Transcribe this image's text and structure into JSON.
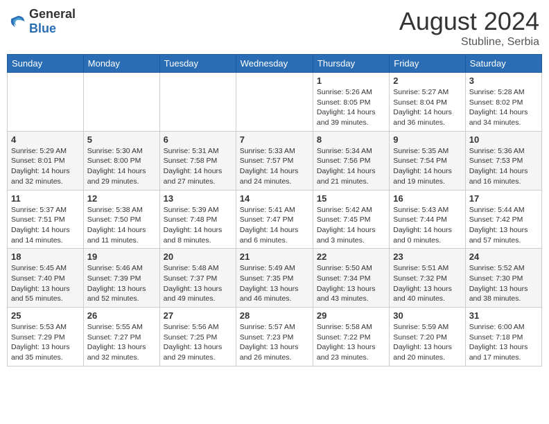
{
  "header": {
    "logo_general": "General",
    "logo_blue": "Blue",
    "title": "August 2024",
    "subtitle": "Stubline, Serbia"
  },
  "weekdays": [
    "Sunday",
    "Monday",
    "Tuesday",
    "Wednesday",
    "Thursday",
    "Friday",
    "Saturday"
  ],
  "weeks": [
    [
      {
        "day": "",
        "detail": ""
      },
      {
        "day": "",
        "detail": ""
      },
      {
        "day": "",
        "detail": ""
      },
      {
        "day": "",
        "detail": ""
      },
      {
        "day": "1",
        "detail": "Sunrise: 5:26 AM\nSunset: 8:05 PM\nDaylight: 14 hours\nand 39 minutes."
      },
      {
        "day": "2",
        "detail": "Sunrise: 5:27 AM\nSunset: 8:04 PM\nDaylight: 14 hours\nand 36 minutes."
      },
      {
        "day": "3",
        "detail": "Sunrise: 5:28 AM\nSunset: 8:02 PM\nDaylight: 14 hours\nand 34 minutes."
      }
    ],
    [
      {
        "day": "4",
        "detail": "Sunrise: 5:29 AM\nSunset: 8:01 PM\nDaylight: 14 hours\nand 32 minutes."
      },
      {
        "day": "5",
        "detail": "Sunrise: 5:30 AM\nSunset: 8:00 PM\nDaylight: 14 hours\nand 29 minutes."
      },
      {
        "day": "6",
        "detail": "Sunrise: 5:31 AM\nSunset: 7:58 PM\nDaylight: 14 hours\nand 27 minutes."
      },
      {
        "day": "7",
        "detail": "Sunrise: 5:33 AM\nSunset: 7:57 PM\nDaylight: 14 hours\nand 24 minutes."
      },
      {
        "day": "8",
        "detail": "Sunrise: 5:34 AM\nSunset: 7:56 PM\nDaylight: 14 hours\nand 21 minutes."
      },
      {
        "day": "9",
        "detail": "Sunrise: 5:35 AM\nSunset: 7:54 PM\nDaylight: 14 hours\nand 19 minutes."
      },
      {
        "day": "10",
        "detail": "Sunrise: 5:36 AM\nSunset: 7:53 PM\nDaylight: 14 hours\nand 16 minutes."
      }
    ],
    [
      {
        "day": "11",
        "detail": "Sunrise: 5:37 AM\nSunset: 7:51 PM\nDaylight: 14 hours\nand 14 minutes."
      },
      {
        "day": "12",
        "detail": "Sunrise: 5:38 AM\nSunset: 7:50 PM\nDaylight: 14 hours\nand 11 minutes."
      },
      {
        "day": "13",
        "detail": "Sunrise: 5:39 AM\nSunset: 7:48 PM\nDaylight: 14 hours\nand 8 minutes."
      },
      {
        "day": "14",
        "detail": "Sunrise: 5:41 AM\nSunset: 7:47 PM\nDaylight: 14 hours\nand 6 minutes."
      },
      {
        "day": "15",
        "detail": "Sunrise: 5:42 AM\nSunset: 7:45 PM\nDaylight: 14 hours\nand 3 minutes."
      },
      {
        "day": "16",
        "detail": "Sunrise: 5:43 AM\nSunset: 7:44 PM\nDaylight: 14 hours\nand 0 minutes."
      },
      {
        "day": "17",
        "detail": "Sunrise: 5:44 AM\nSunset: 7:42 PM\nDaylight: 13 hours\nand 57 minutes."
      }
    ],
    [
      {
        "day": "18",
        "detail": "Sunrise: 5:45 AM\nSunset: 7:40 PM\nDaylight: 13 hours\nand 55 minutes."
      },
      {
        "day": "19",
        "detail": "Sunrise: 5:46 AM\nSunset: 7:39 PM\nDaylight: 13 hours\nand 52 minutes."
      },
      {
        "day": "20",
        "detail": "Sunrise: 5:48 AM\nSunset: 7:37 PM\nDaylight: 13 hours\nand 49 minutes."
      },
      {
        "day": "21",
        "detail": "Sunrise: 5:49 AM\nSunset: 7:35 PM\nDaylight: 13 hours\nand 46 minutes."
      },
      {
        "day": "22",
        "detail": "Sunrise: 5:50 AM\nSunset: 7:34 PM\nDaylight: 13 hours\nand 43 minutes."
      },
      {
        "day": "23",
        "detail": "Sunrise: 5:51 AM\nSunset: 7:32 PM\nDaylight: 13 hours\nand 40 minutes."
      },
      {
        "day": "24",
        "detail": "Sunrise: 5:52 AM\nSunset: 7:30 PM\nDaylight: 13 hours\nand 38 minutes."
      }
    ],
    [
      {
        "day": "25",
        "detail": "Sunrise: 5:53 AM\nSunset: 7:29 PM\nDaylight: 13 hours\nand 35 minutes."
      },
      {
        "day": "26",
        "detail": "Sunrise: 5:55 AM\nSunset: 7:27 PM\nDaylight: 13 hours\nand 32 minutes."
      },
      {
        "day": "27",
        "detail": "Sunrise: 5:56 AM\nSunset: 7:25 PM\nDaylight: 13 hours\nand 29 minutes."
      },
      {
        "day": "28",
        "detail": "Sunrise: 5:57 AM\nSunset: 7:23 PM\nDaylight: 13 hours\nand 26 minutes."
      },
      {
        "day": "29",
        "detail": "Sunrise: 5:58 AM\nSunset: 7:22 PM\nDaylight: 13 hours\nand 23 minutes."
      },
      {
        "day": "30",
        "detail": "Sunrise: 5:59 AM\nSunset: 7:20 PM\nDaylight: 13 hours\nand 20 minutes."
      },
      {
        "day": "31",
        "detail": "Sunrise: 6:00 AM\nSunset: 7:18 PM\nDaylight: 13 hours\nand 17 minutes."
      }
    ]
  ]
}
